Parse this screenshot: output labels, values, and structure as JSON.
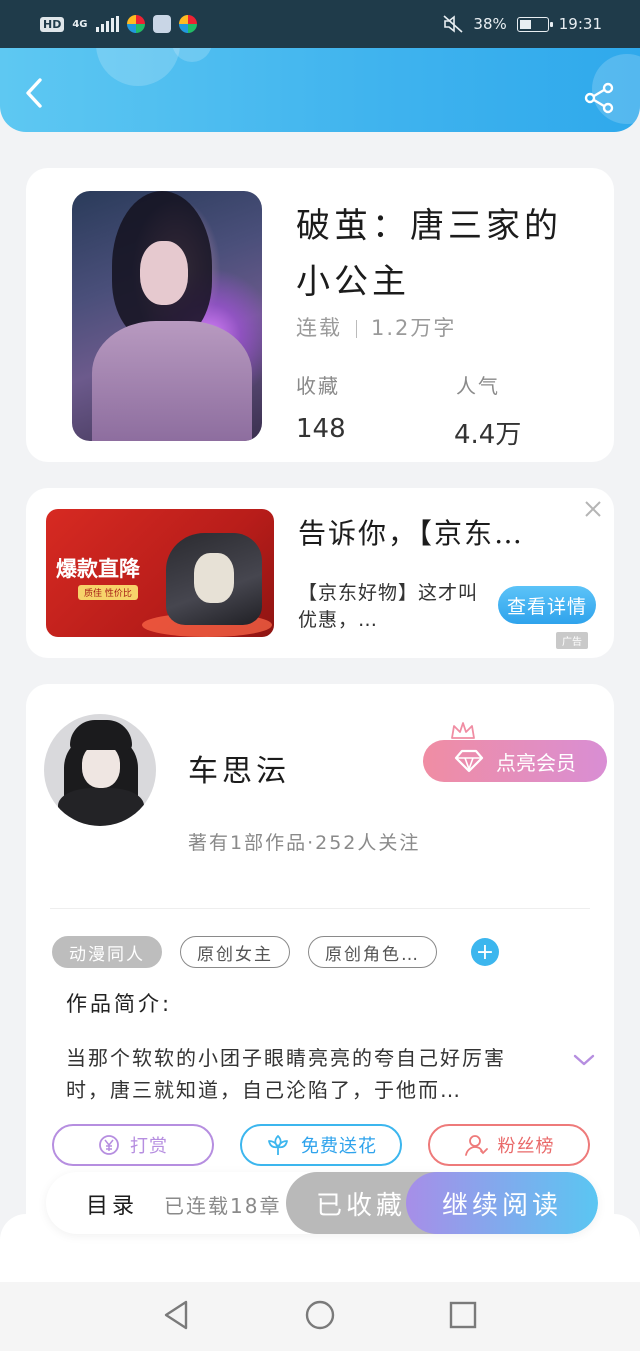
{
  "status_bar": {
    "hd": "HD",
    "network": "4G",
    "battery": "38%",
    "time": "19:31"
  },
  "book": {
    "title": "破茧：唐三家的小公主",
    "status": "连载",
    "word_count": "1.2万字",
    "stats": [
      {
        "label": "收藏",
        "value": "148"
      },
      {
        "label": "人气",
        "value": "4.4万"
      }
    ]
  },
  "ad": {
    "image_text": "爆款直降",
    "image_sub": "质佳 性价比",
    "title": "告诉你，【京东…",
    "desc": "【京东好物】这才叫优惠，…",
    "cta": "查看详情",
    "tag": "广告"
  },
  "author": {
    "name": "车思沄",
    "stats": "著有1部作品·252人关注",
    "vip_button": "点亮会员"
  },
  "tags": [
    "动漫同人",
    "原创女主",
    "原创角色…"
  ],
  "intro": {
    "label": "作品简介:",
    "text": "当那个软软的小团子眼睛亮亮的夸自己好厉害时，唐三就知道，自己沦陷了，于他而…"
  },
  "actions": {
    "reward": "打赏",
    "flower": "免费送花",
    "fans": "粉丝榜"
  },
  "bottom_bar": {
    "toc": "目录",
    "serial": "已连载18章",
    "collected": "已收藏",
    "read": "继续阅读"
  },
  "colors": {
    "header": "#3fb3ee",
    "accent_blue": "#2fa3ec",
    "purple": "#b68ee0",
    "pink": "#ee7a7a"
  },
  "icons": [
    "back-icon",
    "share-icon",
    "close-icon",
    "diamond-icon",
    "crown-icon",
    "add-icon",
    "chevron-down-icon",
    "yen-icon",
    "flower-icon",
    "user-icon",
    "nav-back-icon",
    "nav-home-icon",
    "nav-recent-icon"
  ]
}
